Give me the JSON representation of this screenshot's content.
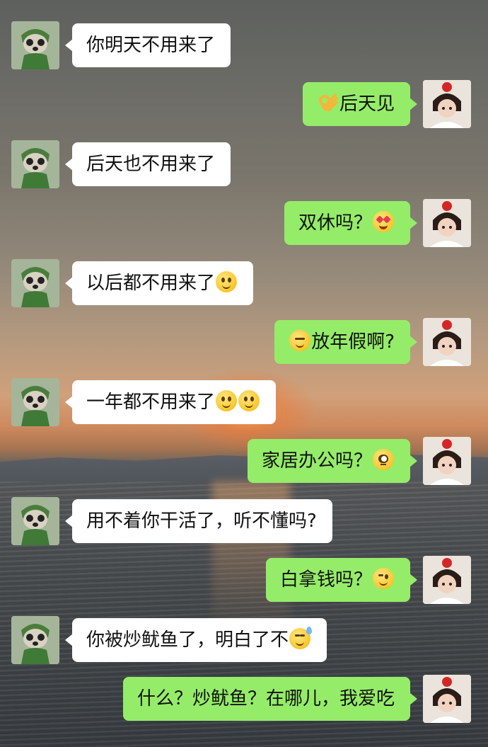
{
  "chat": {
    "messages": [
      {
        "side": "left",
        "text": "你明天不用来了",
        "emoji_after": []
      },
      {
        "side": "right",
        "text": "后天见",
        "emoji_before": [
          "ok-hand-icon"
        ],
        "emoji_after": []
      },
      {
        "side": "left",
        "text": "后天也不用来了",
        "emoji_after": []
      },
      {
        "side": "right",
        "text": "双休吗？",
        "emoji_after": [
          "heart-eyes-icon"
        ]
      },
      {
        "side": "left",
        "text": "以后都不用来了",
        "emoji_after": [
          "smile-icon"
        ]
      },
      {
        "side": "right",
        "text": "放年假啊?",
        "emoji_before": [
          "squint-smile-icon"
        ],
        "emoji_after": []
      },
      {
        "side": "left",
        "text": "一年都不用来了",
        "emoji_after": [
          "smile-icon",
          "smile-icon"
        ]
      },
      {
        "side": "right",
        "text": "家居办公吗？",
        "emoji_after": [
          "flushed-icon"
        ]
      },
      {
        "side": "left",
        "text": "用不着你干活了，听不懂吗?",
        "emoji_after": []
      },
      {
        "side": "right",
        "text": "白拿钱吗？",
        "emoji_after": [
          "thinking-icon"
        ]
      },
      {
        "side": "left",
        "text": "你被炒鱿鱼了，明白了不",
        "emoji_after": [
          "sweat-icon"
        ]
      },
      {
        "side": "right",
        "text": "什么？炒鱿鱼？在哪儿，我爱吃",
        "emoji_after": []
      }
    ]
  },
  "colors": {
    "incoming_bubble": "#ffffff",
    "outgoing_bubble": "#95ec69"
  }
}
